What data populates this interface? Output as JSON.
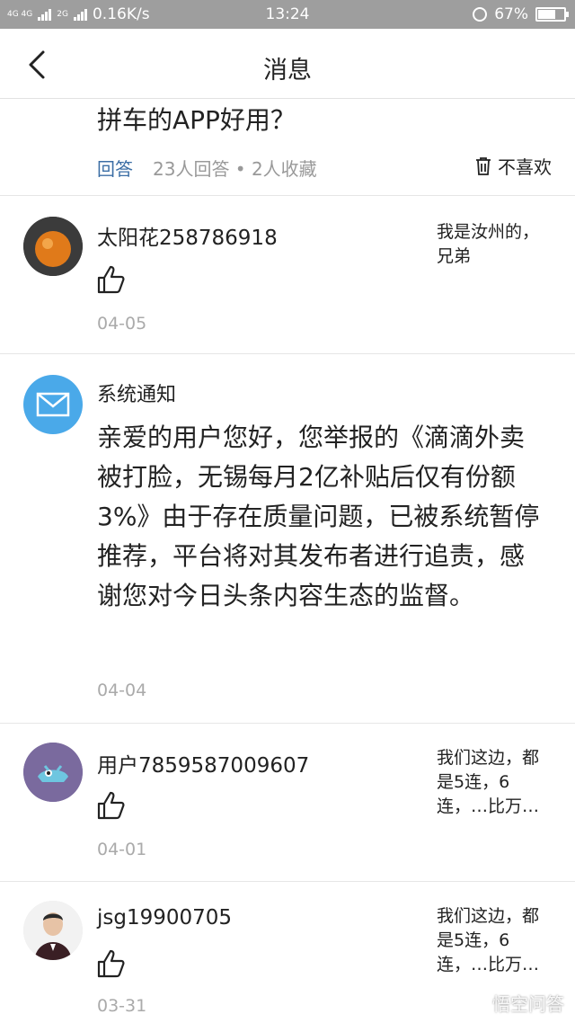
{
  "status": {
    "network": "4G 4G",
    "network2": "2G",
    "speed": "0.16K/s",
    "time": "13:24",
    "battery": "67%",
    "battery_level": 0.67
  },
  "nav": {
    "title": "消息"
  },
  "question": {
    "title": "拼车的APP好用？",
    "answer_label": "回答",
    "stats": "23人回答 • 2人收藏",
    "dislike_label": "不喜欢"
  },
  "messages": [
    {
      "author": "太阳花258786918",
      "quote": "我是汝州的，兄弟",
      "date": "04-05",
      "avatar": "orange-avatar"
    },
    {
      "author": "系统通知",
      "body": "亲爱的用户您好，您举报的《滴滴外卖被打脸，无锡每月2亿补贴后仅有份额3%》由于存在质量问题，已被系统暂停推荐，平台将对其发布者进行追责，感谢您对今日头条内容生态的监督。",
      "date": "04-04",
      "avatar": "mail-icon"
    },
    {
      "author": "用户7859587009607",
      "quote": "我们这边，都是5连，6连，…比万…",
      "date": "04-01",
      "avatar": "monster-avatar"
    },
    {
      "author": "jsg19900705",
      "quote": "我们这边，都是5连，6连，…比万…",
      "date": "03-31",
      "avatar": "person-avatar"
    }
  ],
  "watermark": "悟空问答"
}
